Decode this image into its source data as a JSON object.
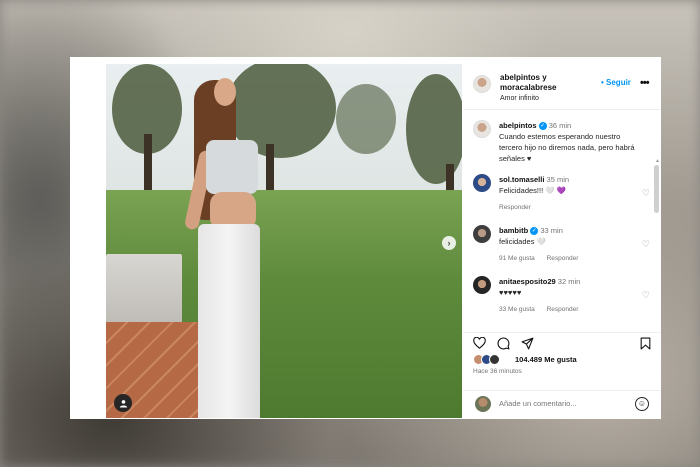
{
  "post": {
    "header": {
      "user_line1": "abelpintos y",
      "user_line2": "moracalabrese",
      "subtitle": "Amor infinito",
      "follow_label": "• Seguir",
      "more_icon": "more-horizontal-icon"
    },
    "caption": {
      "user": "abelpintos",
      "verified": true,
      "time": "36 min",
      "text": "Cuando estemos esperando nuestro tercero hijo no diremos nada, pero habrá señales ♥"
    },
    "comments": [
      {
        "user": "sol.tomaselli",
        "verified": false,
        "time": "35 min",
        "text": "Felicidades!!! 🤍 💜",
        "meta": [
          "Responder"
        ]
      },
      {
        "user": "bambitb",
        "verified": true,
        "time": "33 min",
        "text": "felicidades 🤍",
        "meta": [
          "91 Me gusta",
          "Responder"
        ]
      },
      {
        "user": "anitaesposito29",
        "verified": false,
        "time": "32 min",
        "text": "♥♥♥♥♥",
        "meta": [
          "33 Me gusta",
          "Responder"
        ]
      }
    ],
    "likes": {
      "count_text": "104.489",
      "suffix": " Me gusta"
    },
    "posted_ago": "Hace 36 minutos",
    "comment_placeholder": "Añade un comentario...",
    "icons": {
      "like": "heart-icon",
      "comment": "comment-icon",
      "share": "send-icon",
      "save": "bookmark-icon",
      "emoji": "emoji-icon",
      "tag": "user-tag-icon",
      "next": "chevron-right-icon"
    },
    "colors": {
      "accent": "#0095f6",
      "text": "#262626",
      "muted": "#737373"
    }
  }
}
